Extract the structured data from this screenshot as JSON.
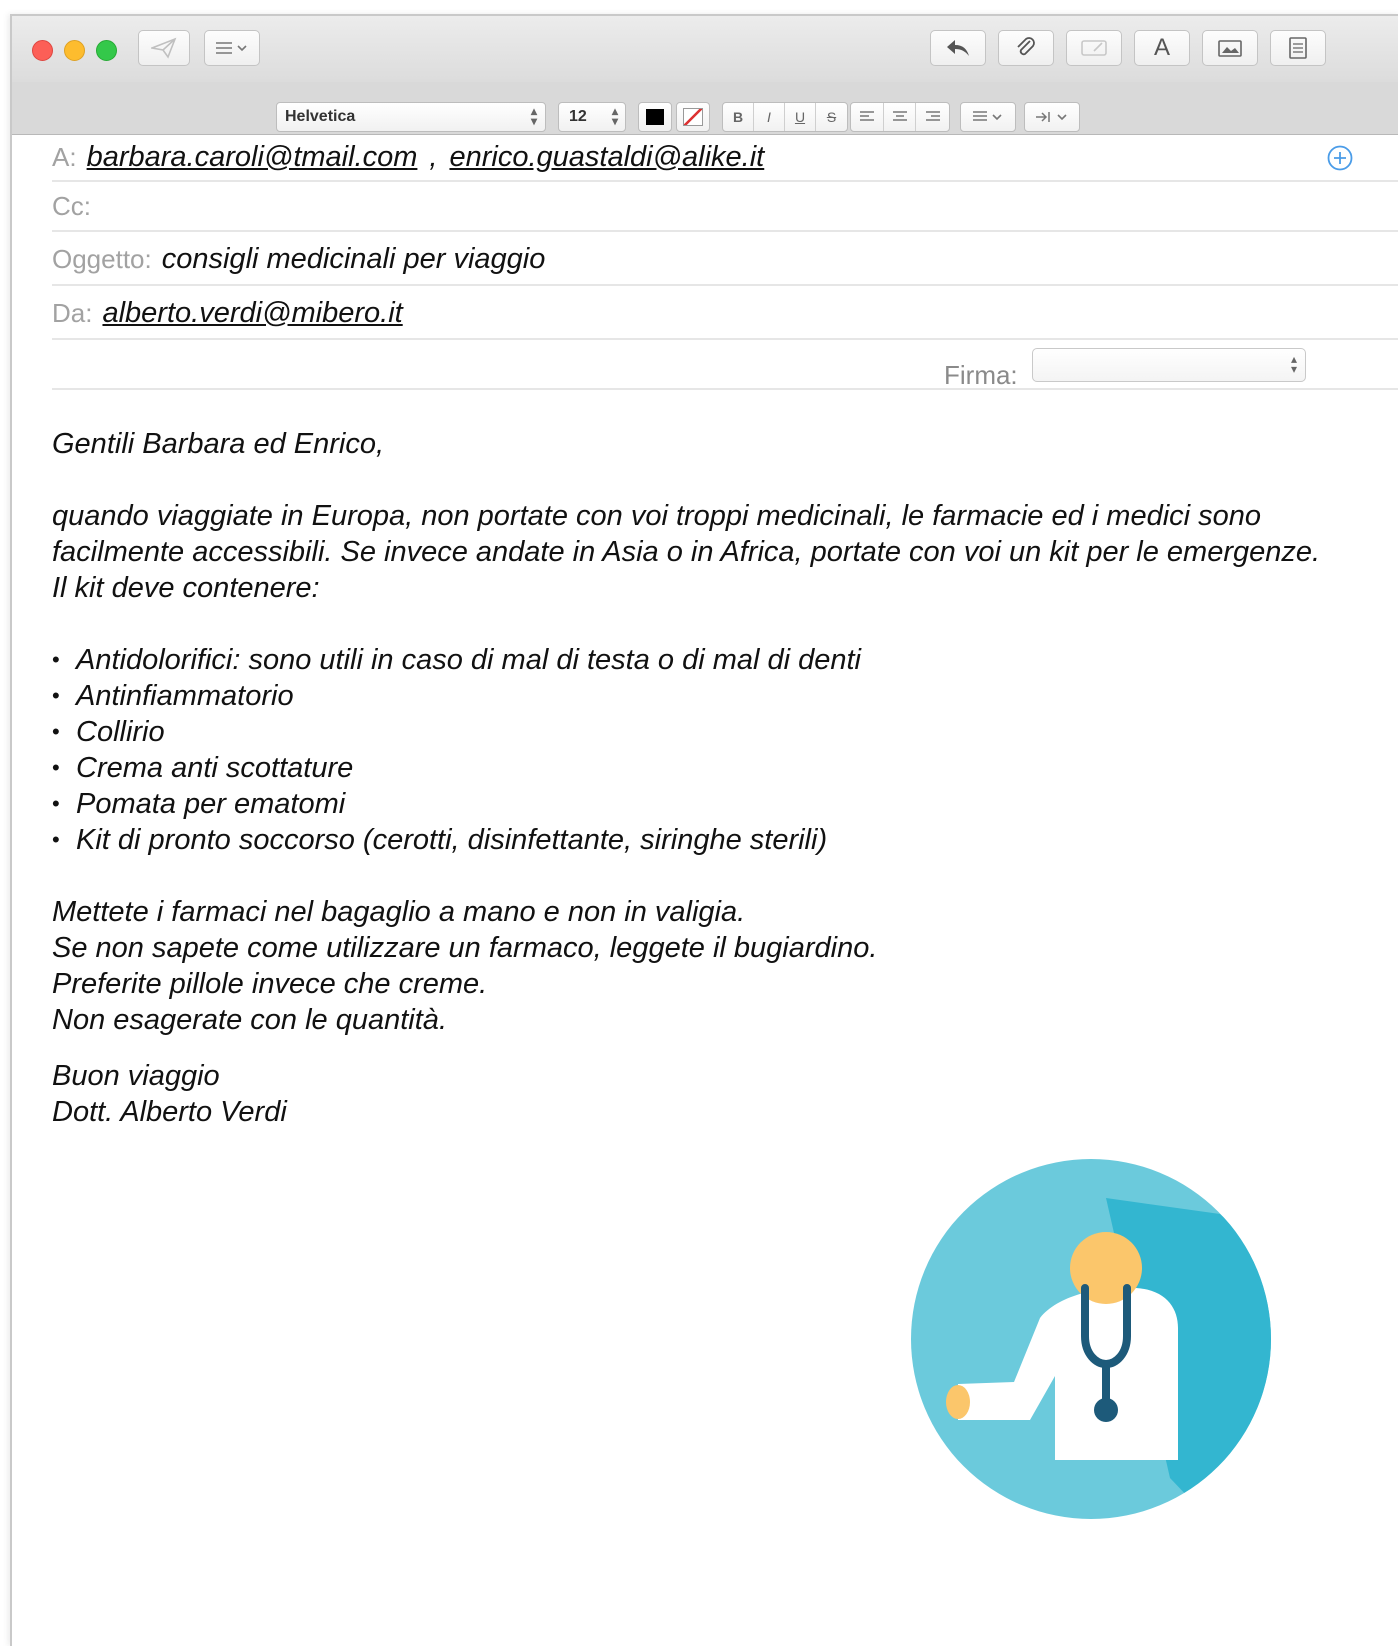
{
  "toolbar": {
    "send_icon": "paper-plane-icon",
    "header_fields_icon": "list-icon",
    "reply_icon": "reply-arrow-icon",
    "attach_icon": "paperclip-icon",
    "markup_icon": "markup-icon",
    "fonts_button": "A",
    "photo_icon": "photo-browser-icon",
    "template_icon": "stationery-icon"
  },
  "format_bar": {
    "font": "Helvetica",
    "size": "12",
    "bold": "B",
    "italic": "I",
    "underline": "U",
    "strike": "S"
  },
  "header": {
    "to_label": "A:",
    "to_addresses": [
      "barbara.caroli@tmail.com",
      "enrico.guastaldi@alike.it"
    ],
    "to_separator": ",",
    "cc_label": "Cc:",
    "subject_label": "Oggetto:",
    "subject": "consigli medicinali per viaggio",
    "from_label": "Da:",
    "from": "alberto.verdi@mibero.it",
    "signature_label": "Firma:",
    "signature_value": ""
  },
  "message": {
    "greeting": "Gentili Barbara ed Enrico,",
    "intro": "quando viaggiate in Europa, non portate con voi troppi medicinali, le farmacie ed i medici sono facilmente accessibili. Se invece andate in Asia o in Africa, portate con voi un kit per le emergenze. Il kit deve contenere:",
    "kit_items": [
      "Antidolorifici: sono utili in caso di mal di testa o di mal di denti",
      "Antinfiammatorio",
      "Collirio",
      "Crema anti scottature",
      "Pomata per ematomi",
      "Kit di pronto soccorso (cerotti, disinfettante, siringhe sterili)"
    ],
    "advice": [
      "Mettete i farmaci nel bagaglio a mano e non in valigia.",
      "Se non sapete come utilizzare un farmaco, leggete il bugiardino.",
      "Preferite pillole invece che creme.",
      "Non esagerate con le quantità."
    ],
    "closing": "Buon viaggio",
    "signature": "Dott. Alberto Verdi"
  },
  "colors": {
    "close": "#fc5f57",
    "minimize": "#fdbc2e",
    "zoom": "#34c84a",
    "accent_blue": "#4a9ce8",
    "doctor_circle": "#6bcadc",
    "doctor_shadow": "#33b6d0",
    "doctor_skin": "#fbc66b",
    "stethoscope": "#1d5a7a"
  }
}
